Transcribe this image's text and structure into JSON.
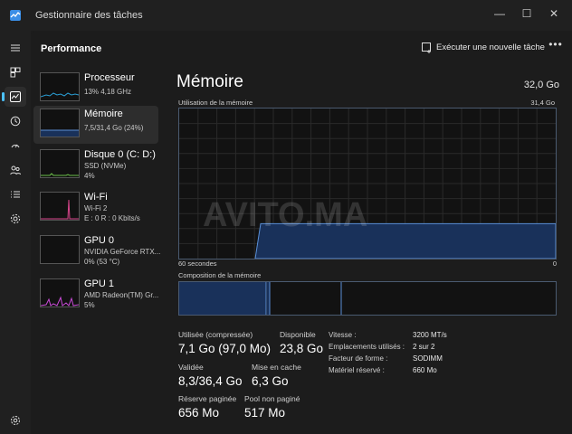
{
  "window": {
    "title": "Gestionnaire des tâches",
    "minimize": "—",
    "maximize": "☐",
    "close": "✕"
  },
  "nav": {
    "icons": [
      "menu-icon",
      "processes-icon",
      "performance-icon",
      "history-icon",
      "startup-icon",
      "users-icon",
      "details-icon",
      "services-icon",
      "settings-icon"
    ]
  },
  "header": {
    "title": "Performance",
    "run_task": "Exécuter une nouvelle tâche",
    "more": "•••"
  },
  "devices": [
    {
      "name": "Processeur",
      "line1": "13%  4,18 GHz",
      "line2": ""
    },
    {
      "name": "Mémoire",
      "line1": "7,5/31,4 Go (24%)",
      "line2": ""
    },
    {
      "name": "Disque 0 (C: D:)",
      "line1": "SSD (NVMe)",
      "line2": "4%"
    },
    {
      "name": "Wi-Fi",
      "line1": "Wi-Fi 2",
      "line2": "E : 0  R : 0 Kbits/s"
    },
    {
      "name": "GPU 0",
      "line1": "NVIDIA GeForce RTX...",
      "line2": "0%  (53 °C)"
    },
    {
      "name": "GPU 1",
      "line1": "AMD Radeon(TM) Gr...",
      "line2": "5%"
    }
  ],
  "memory": {
    "title": "Mémoire",
    "total": "32,0 Go",
    "usage_label": "Utilisation de la mémoire",
    "usage_max": "31,4 Go",
    "axis_left": "60 secondes",
    "axis_right": "0",
    "composition_label": "Composition de la mémoire",
    "usage_fraction": 0.24,
    "stats": {
      "in_use_label": "Utilisée (compressée)",
      "in_use_value": "7,1 Go (97,0 Mo)",
      "available_label": "Disponible",
      "available_value": "23,8 Go",
      "committed_label": "Validée",
      "committed_value": "8,3/36,4 Go",
      "cached_label": "Mise en cache",
      "cached_value": "6,3 Go",
      "paged_label": "Réserve paginée",
      "paged_value": "656 Mo",
      "nonpaged_label": "Pool non paginé",
      "nonpaged_value": "517 Mo"
    },
    "specs": {
      "speed_label": "Vitesse :",
      "speed_value": "3200 MT/s",
      "slots_label": "Emplacements utilisés :",
      "slots_value": "2 sur 2",
      "form_label": "Facteur de forme :",
      "form_value": "SODIMM",
      "reserved_label": "Matériel réservé :",
      "reserved_value": "660 Mo"
    }
  },
  "watermark": "AVITO.MA",
  "colors": {
    "accent": "#4cc2ff",
    "memory_line": "#5a8fd6",
    "memory_fill": "#19315a",
    "cpu_line": "#2a9fd6",
    "disk_line": "#6cc04a",
    "wifi_line": "#d6448a",
    "gpu_line": "#c84ad6"
  }
}
